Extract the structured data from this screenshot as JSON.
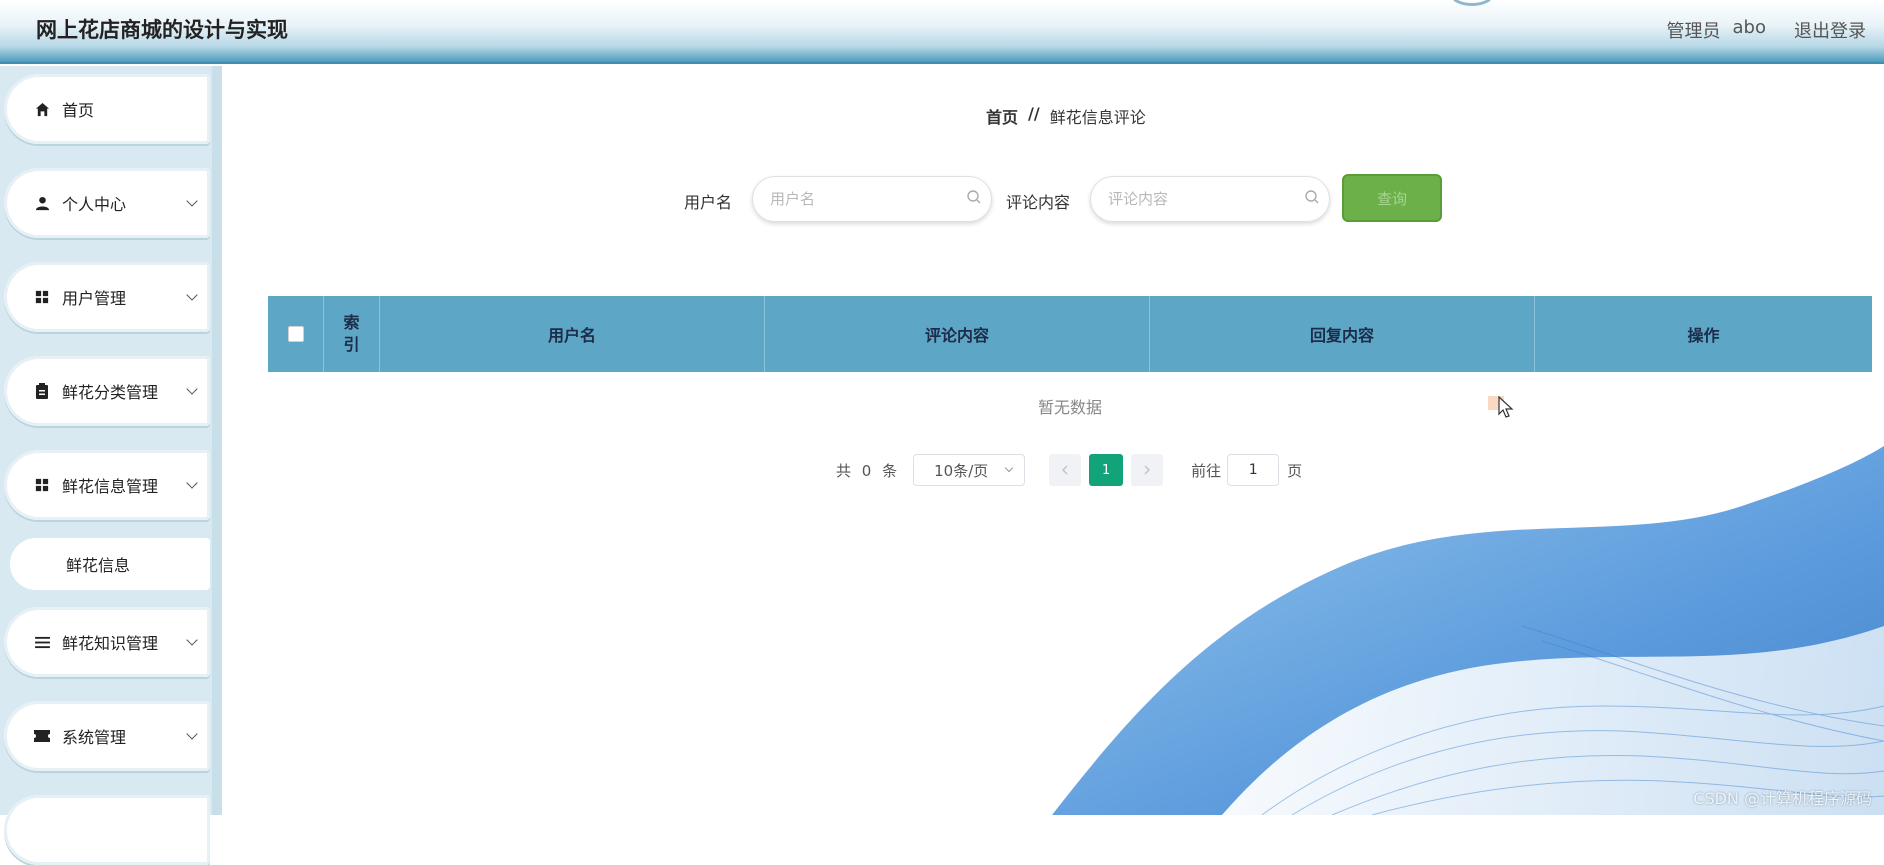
{
  "header": {
    "app_title": "网上花店商城的设计与实现",
    "role": "管理员",
    "username": "abo",
    "logout": "退出登录"
  },
  "sidebar": {
    "items": [
      {
        "label": "首页",
        "icon": "home-icon",
        "expandable": false
      },
      {
        "label": "个人中心",
        "icon": "person-icon",
        "expandable": true
      },
      {
        "label": "用户管理",
        "icon": "grid-icon",
        "expandable": true
      },
      {
        "label": "鲜花分类管理",
        "icon": "clipboard-icon",
        "expandable": true
      },
      {
        "label": "鲜花信息管理",
        "icon": "grid-icon",
        "expandable": true
      },
      {
        "label": "鲜花知识管理",
        "icon": "list-icon",
        "expandable": true
      },
      {
        "label": "系统管理",
        "icon": "ticket-icon",
        "expandable": true
      }
    ],
    "submenu": {
      "label": "鲜花信息"
    }
  },
  "breadcrumb": {
    "home": "首页",
    "separator": "//",
    "current": "鲜花信息评论"
  },
  "search": {
    "username_label": "用户名",
    "username_placeholder": "用户名",
    "username_value": "",
    "comment_label": "评论内容",
    "comment_placeholder": "评论内容",
    "comment_value": "",
    "query_button": "查询"
  },
  "table": {
    "columns": [
      "索引",
      "用户名",
      "评论内容",
      "回复内容",
      "操作"
    ],
    "rows": [],
    "empty_text": "暂无数据"
  },
  "pagination": {
    "total_prefix": "共",
    "total": "0",
    "total_suffix": "条",
    "page_size": "10条/页",
    "current_page": "1",
    "goto_label": "前往",
    "goto_value": "1",
    "page_suffix": "页"
  },
  "watermark": "CSDN @计算机程序源码",
  "colors": {
    "table_header": "#5ea6c6",
    "query_button": "#6cb04a",
    "active_page": "#13a37a",
    "wave": "#4a90d9"
  }
}
